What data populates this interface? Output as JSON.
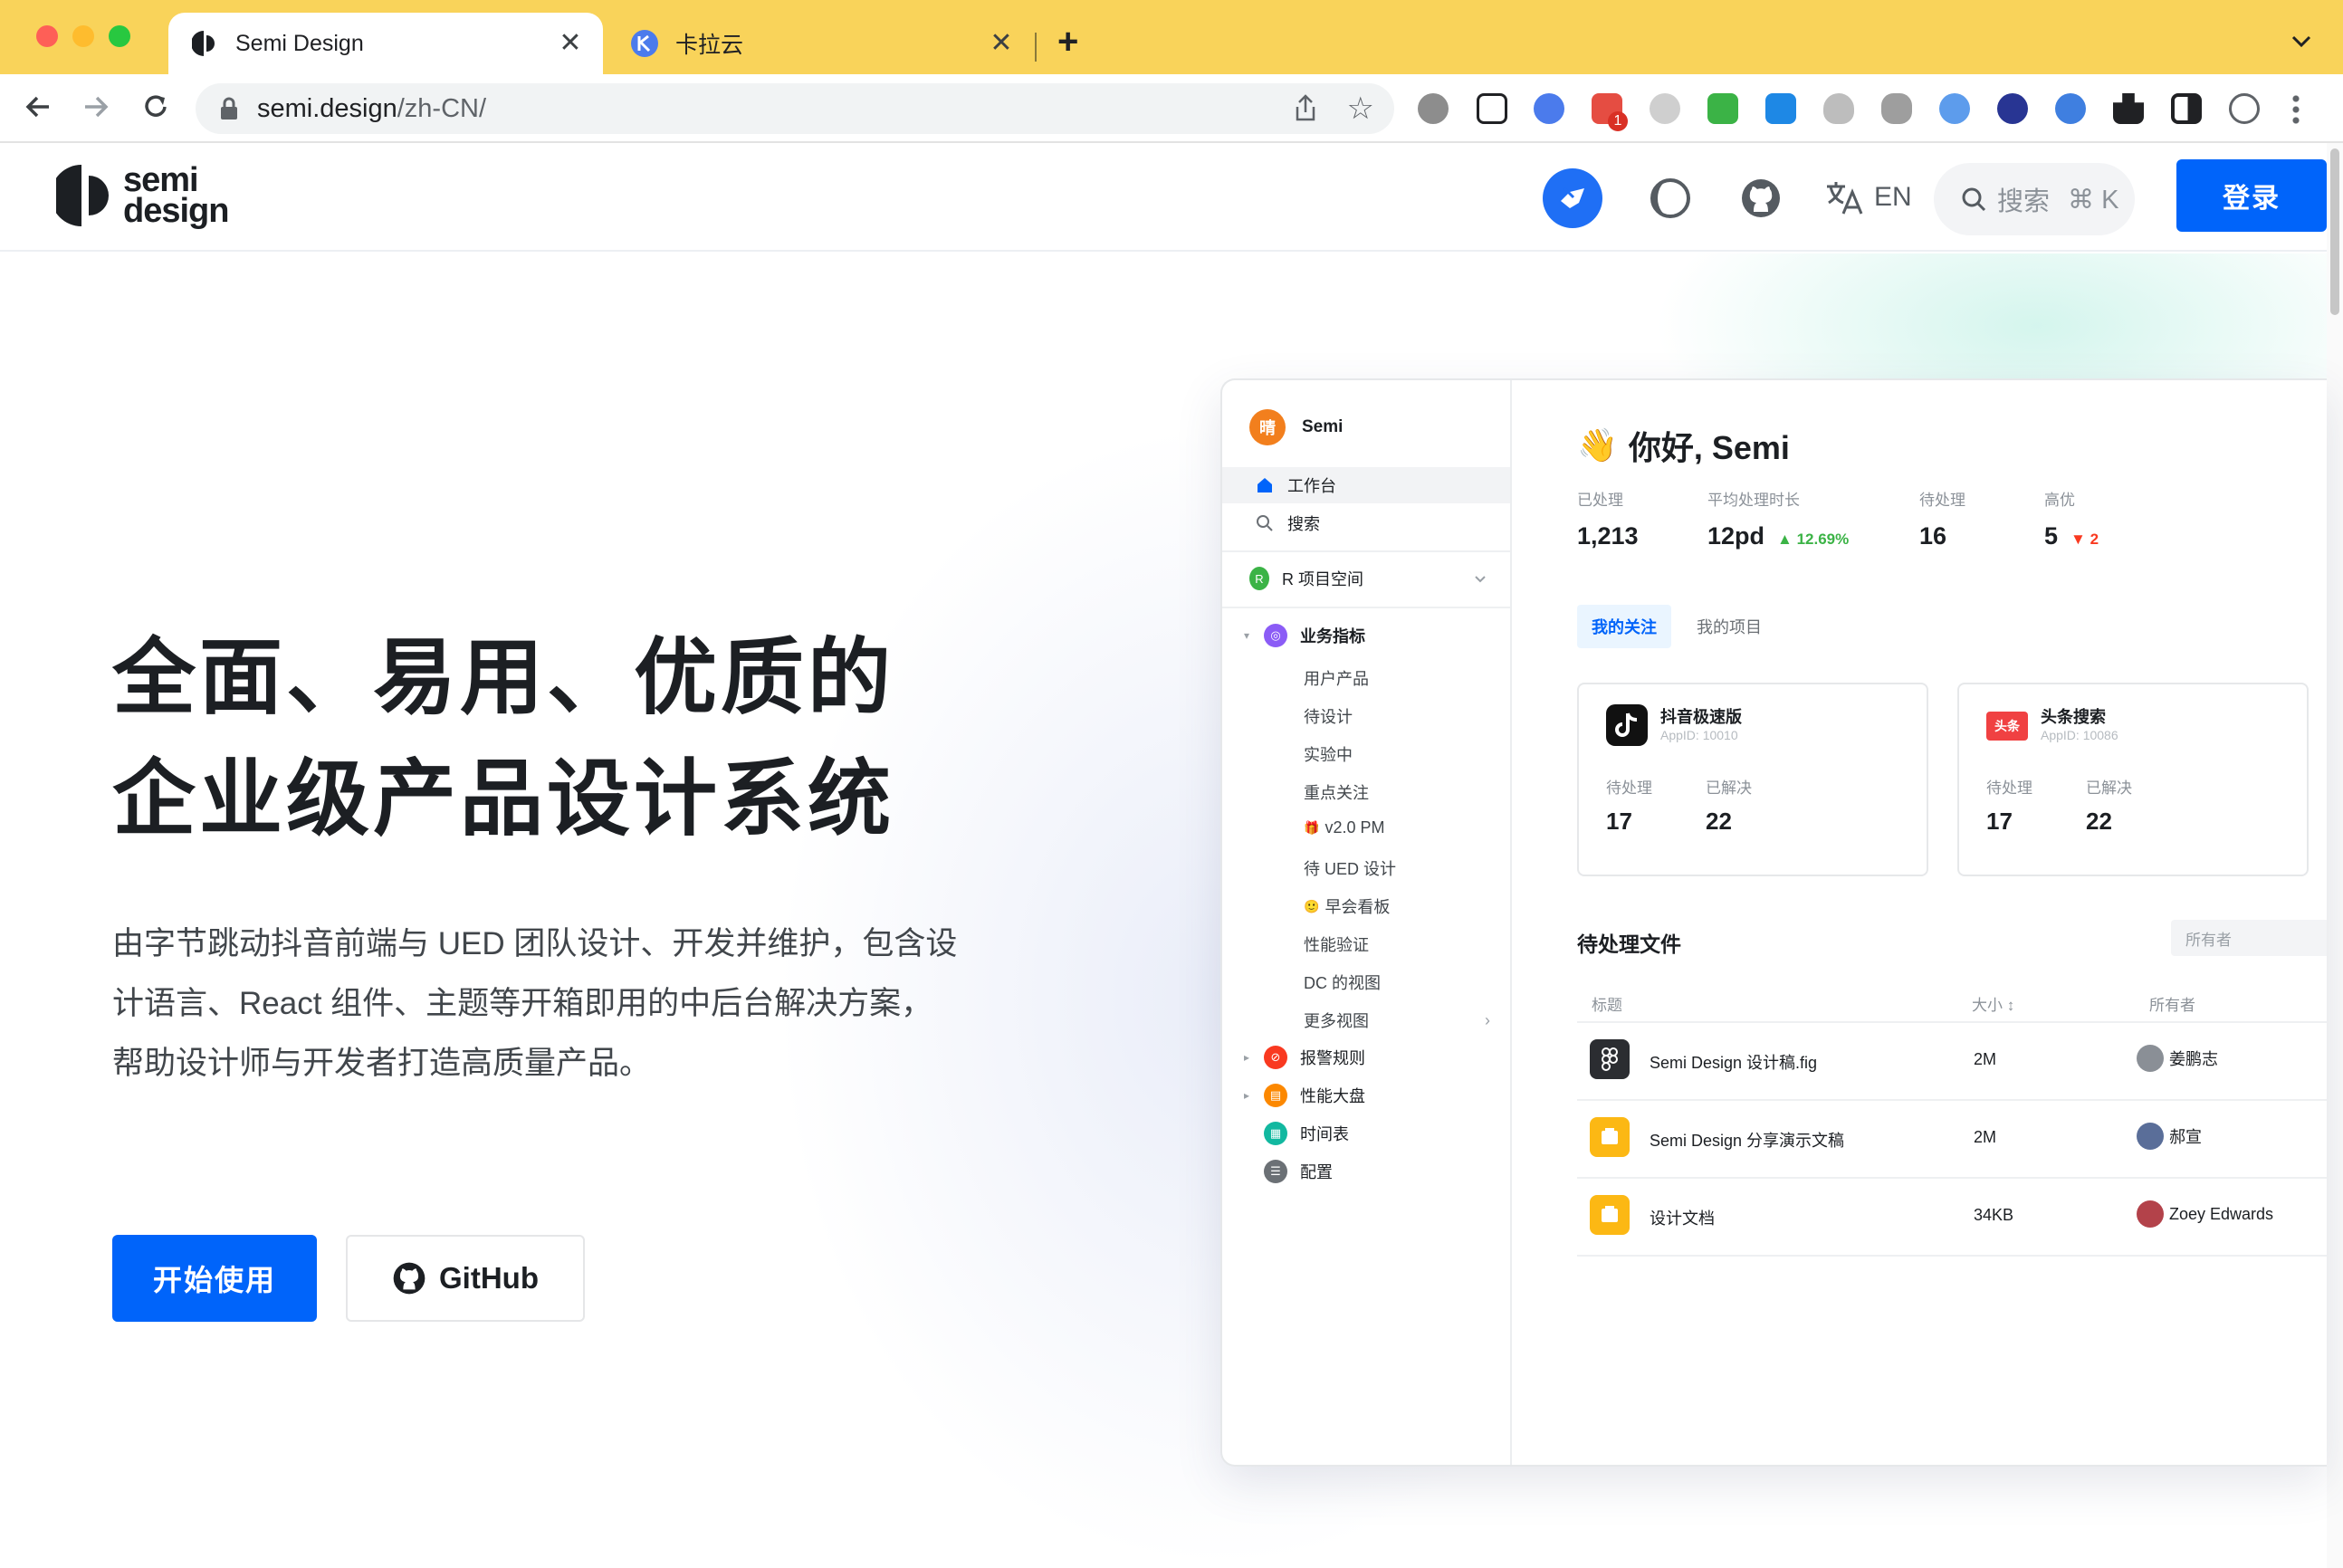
{
  "browser": {
    "tabs": [
      {
        "title": "Semi Design",
        "close": "✕"
      },
      {
        "title": "卡拉云",
        "close": "✕"
      }
    ],
    "new_tab": "+",
    "tab_menu": "⌄",
    "url_host": "semi.design",
    "url_path": "/zh-CN/",
    "extension_badge": "1"
  },
  "header": {
    "logo_line1": "semi",
    "logo_line2": "design",
    "lang_label": "EN",
    "search_placeholder": "搜索",
    "search_shortcut": "⌘ K",
    "login_label": "登录"
  },
  "hero": {
    "title_line1": "全面、易用、优质的",
    "title_line2": "企业级产品设计系统",
    "desc_line1": "由字节跳动抖音前端与 UED 团队设计、开发并维护，包含设",
    "desc_line2": "计语言、React 组件、主题等开箱即用的中后台解决方案，",
    "desc_line3": "帮助设计师与开发者打造高质量产品。",
    "primary_cta": "开始使用",
    "secondary_cta": "GitHub"
  },
  "mock": {
    "workspace_avatar": "晴",
    "workspace_name": "Semi",
    "nav_home": "工作台",
    "nav_search": "搜索",
    "project_space": "R 项目空间",
    "project_letter": "R",
    "tree": {
      "group1": "业务指标",
      "children": [
        "用户产品",
        "待设计",
        "实验中",
        "重点关注",
        "v2.0 PM",
        "待 UED 设计",
        "早会看板",
        "性能验证",
        "DC 的视图",
        "更多视图"
      ],
      "group2": "报警规则",
      "group3": "性能大盘",
      "group4": "时间表",
      "group5": "配置"
    },
    "greeting_emoji": "👋",
    "greeting": "你好, Semi",
    "stats": [
      {
        "label": "已处理",
        "value": "1,213",
        "delta": ""
      },
      {
        "label": "平均处理时长",
        "value": "12pd",
        "delta": "▲ 12.69%"
      },
      {
        "label": "待处理",
        "value": "16",
        "delta": ""
      },
      {
        "label": "高优",
        "value": "5",
        "delta": "▼ 2"
      }
    ],
    "tab_on": "我的关注",
    "tab_off": "我的项目",
    "cards": [
      {
        "name": "抖音极速版",
        "appid": "AppID: 10010",
        "k1": "待处理",
        "v1": "17",
        "k2": "已解决",
        "v2": "22"
      },
      {
        "name": "头条搜索",
        "icon_text": "头条",
        "appid": "AppID: 10086",
        "k1": "待处理",
        "v1": "17",
        "k2": "已解决",
        "v2": "22"
      }
    ],
    "files_title": "待处理文件",
    "owner_filter": "所有者",
    "columns": {
      "title": "标题",
      "size": "大小 ↕",
      "owner": "所有者"
    },
    "files": [
      {
        "name": "Semi Design 设计稿.fig",
        "size": "2M",
        "owner": "姜鹏志"
      },
      {
        "name": "Semi Design 分享演示文稿",
        "size": "2M",
        "owner": "郝宣"
      },
      {
        "name": "设计文档",
        "size": "34KB",
        "owner": "Zoey Edwards"
      }
    ]
  },
  "colors": {
    "brand": "#0064fa",
    "chrome_tabbar": "#f9d35a",
    "up": "#3bb346",
    "down": "#f93920"
  }
}
